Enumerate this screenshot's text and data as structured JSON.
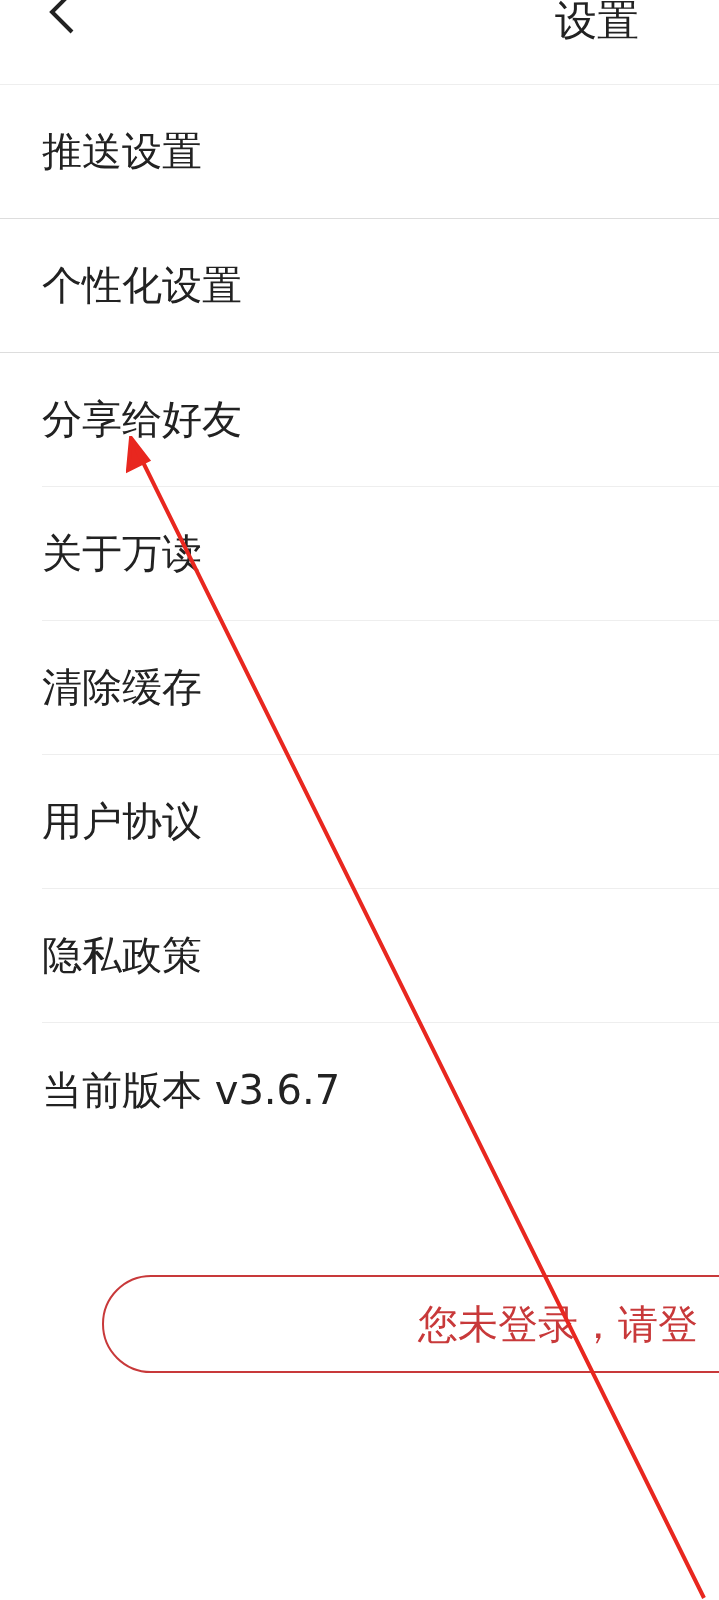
{
  "header": {
    "title": "设置"
  },
  "items": [
    {
      "label": "推送设置"
    },
    {
      "label": "个性化设置"
    },
    {
      "label": "分享给好友"
    },
    {
      "label": "关于万读"
    },
    {
      "label": "清除缓存"
    },
    {
      "label": "用户协议"
    },
    {
      "label": "隐私政策"
    },
    {
      "label": "当前版本 v3.6.7"
    }
  ],
  "login_button": "您未登录，请登"
}
